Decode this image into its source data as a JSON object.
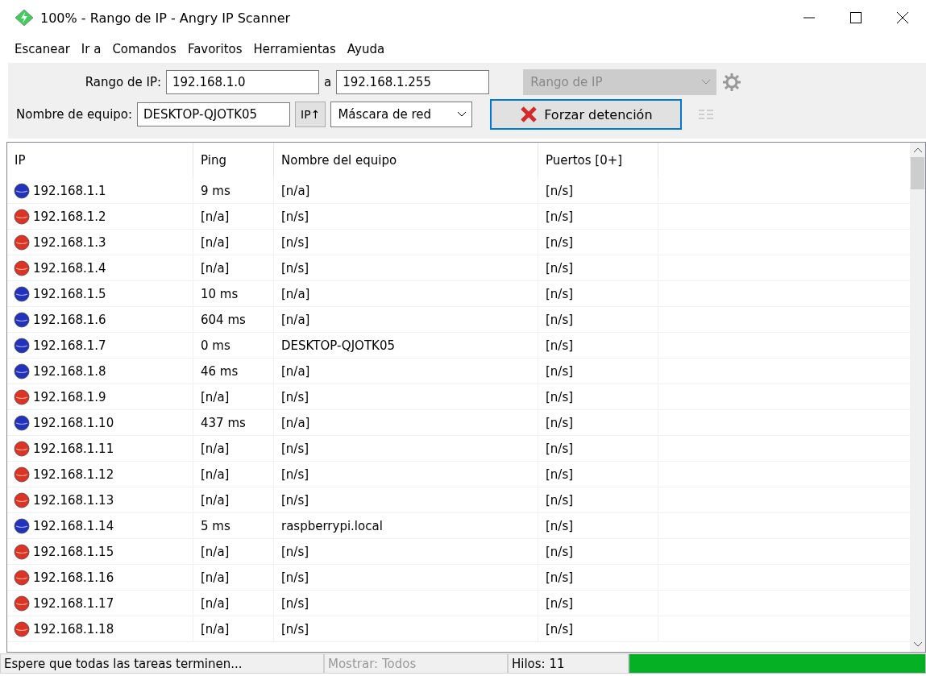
{
  "window": {
    "title": "100% - Rango de IP - Angry IP Scanner"
  },
  "menu": [
    "Escanear",
    "Ir a",
    "Comandos",
    "Favoritos",
    "Herramientas",
    "Ayuda"
  ],
  "toolbar": {
    "range_label": "Rango de IP:",
    "range_from": "192.168.1.0",
    "range_sep": "a",
    "range_to": "192.168.1.255",
    "feeder": {
      "value": "Rango de IP",
      "disabled": true
    },
    "host_label": "Nombre de equipo:",
    "host_value": "DESKTOP-QJOTK05",
    "ip_button": "IP↑",
    "mask": {
      "value": "Máscara de red",
      "disabled": false
    },
    "stop_button": "Forzar detención"
  },
  "table": {
    "columns": [
      "IP",
      "Ping",
      "Nombre del equipo",
      "Puertos [0+]"
    ],
    "rows": [
      {
        "alive": true,
        "cells": [
          "192.168.1.1",
          "9 ms",
          "[n/a]",
          "[n/s]"
        ]
      },
      {
        "alive": false,
        "cells": [
          "192.168.1.2",
          "[n/a]",
          "[n/s]",
          "[n/s]"
        ]
      },
      {
        "alive": false,
        "cells": [
          "192.168.1.3",
          "[n/a]",
          "[n/s]",
          "[n/s]"
        ]
      },
      {
        "alive": false,
        "cells": [
          "192.168.1.4",
          "[n/a]",
          "[n/s]",
          "[n/s]"
        ]
      },
      {
        "alive": true,
        "cells": [
          "192.168.1.5",
          "10 ms",
          "[n/a]",
          "[n/s]"
        ]
      },
      {
        "alive": true,
        "cells": [
          "192.168.1.6",
          "604 ms",
          "[n/a]",
          "[n/s]"
        ]
      },
      {
        "alive": true,
        "cells": [
          "192.168.1.7",
          "0 ms",
          "DESKTOP-QJOTK05",
          "[n/s]"
        ]
      },
      {
        "alive": true,
        "cells": [
          "192.168.1.8",
          "46 ms",
          "[n/a]",
          "[n/s]"
        ]
      },
      {
        "alive": false,
        "cells": [
          "192.168.1.9",
          "[n/a]",
          "[n/s]",
          "[n/s]"
        ]
      },
      {
        "alive": true,
        "cells": [
          "192.168.1.10",
          "437 ms",
          "[n/a]",
          "[n/s]"
        ]
      },
      {
        "alive": false,
        "cells": [
          "192.168.1.11",
          "[n/a]",
          "[n/s]",
          "[n/s]"
        ]
      },
      {
        "alive": false,
        "cells": [
          "192.168.1.12",
          "[n/a]",
          "[n/s]",
          "[n/s]"
        ]
      },
      {
        "alive": false,
        "cells": [
          "192.168.1.13",
          "[n/a]",
          "[n/s]",
          "[n/s]"
        ]
      },
      {
        "alive": true,
        "cells": [
          "192.168.1.14",
          "5 ms",
          "raspberrypi.local",
          "[n/s]"
        ]
      },
      {
        "alive": false,
        "cells": [
          "192.168.1.15",
          "[n/a]",
          "[n/s]",
          "[n/s]"
        ]
      },
      {
        "alive": false,
        "cells": [
          "192.168.1.16",
          "[n/a]",
          "[n/s]",
          "[n/s]"
        ]
      },
      {
        "alive": false,
        "cells": [
          "192.168.1.17",
          "[n/a]",
          "[n/s]",
          "[n/s]"
        ]
      },
      {
        "alive": false,
        "cells": [
          "192.168.1.18",
          "[n/a]",
          "[n/s]",
          "[n/s]"
        ]
      }
    ]
  },
  "status_bar": {
    "message": "Espere que todas las tareas terminen...",
    "display": {
      "text": "Mostrar: Todos",
      "disabled": true
    },
    "threads": "Hilos: 11",
    "progress": {
      "level": 1
    }
  }
}
